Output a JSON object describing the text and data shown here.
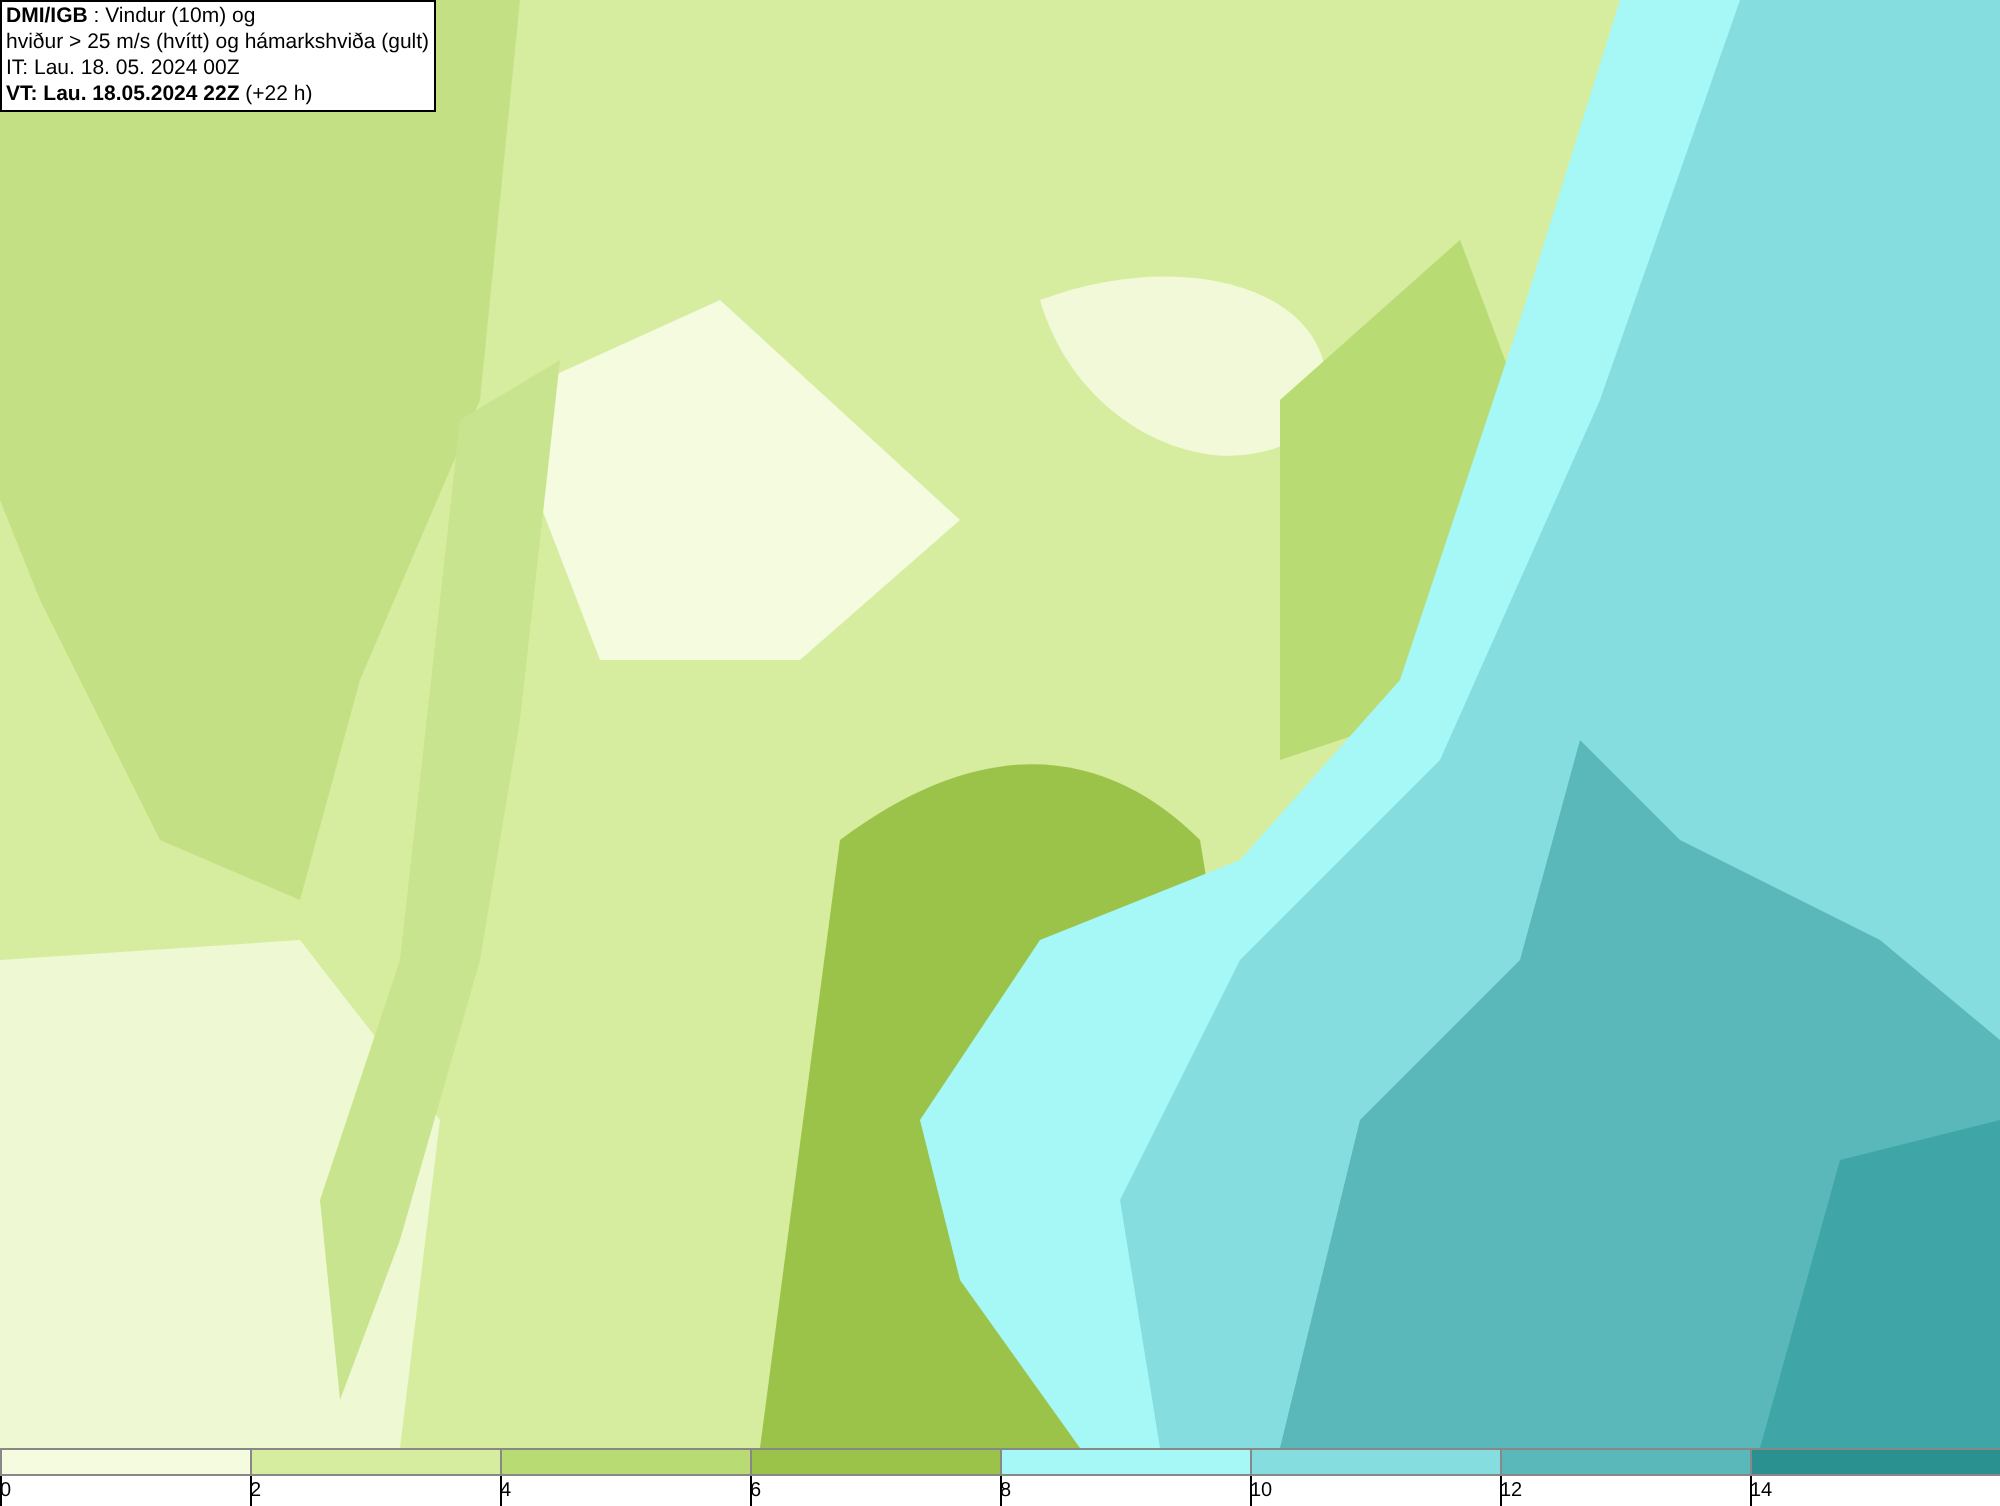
{
  "info_box": {
    "lines": [
      "**DMI/IGB** : Vindur (10m) og",
      "hviður > 25 m/s (hvítt) og hámarkshviða (gult)",
      "IT: Lau. 18. 05. 2024 00Z",
      "**VT: Lau. 18.05.2024 22Z** (+22 h)"
    ]
  },
  "legend": {
    "segments": [
      {
        "color": "#f4fbdf",
        "label": "0"
      },
      {
        "color": "#d6ec9e",
        "label": "2"
      },
      {
        "color": "#b9db74",
        "label": "4"
      },
      {
        "color": "#9bc34a",
        "label": "6"
      },
      {
        "color": "#a6f8f6",
        "label": "8"
      },
      {
        "color": "#86dde0",
        "label": "10"
      },
      {
        "color": "#5ab8bb",
        "label": "12"
      },
      {
        "color": "#2b9190",
        "label": "14"
      }
    ]
  }
}
